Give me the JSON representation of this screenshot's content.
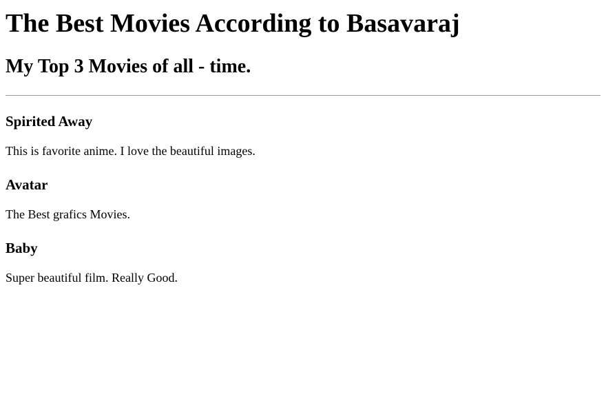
{
  "page": {
    "title": "The Best Movies According to Basavaraj",
    "subtitle": "My Top 3 Movies of all - time."
  },
  "movies": [
    {
      "title": "Spirited Away",
      "description": "This is favorite anime. I love the beautiful images."
    },
    {
      "title": "Avatar",
      "description": "The Best grafics Movies."
    },
    {
      "title": "Baby",
      "description": "Super beautiful film. Really Good."
    }
  ]
}
